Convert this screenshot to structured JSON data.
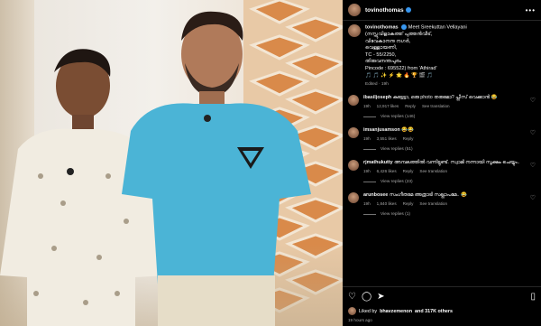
{
  "post": {
    "username": "tovinothomas"
  },
  "caption": {
    "username": "tovinothomas",
    "mention": "@",
    "line1": "Meet Sreekuttan Vellayani",
    "line2": "(നസ്സുവിളാകത്ത് പുത്തൻവീട്,",
    "line3": "വിവേകാനന്ദ നഗർ,",
    "line4": "വെള്ളായണി,",
    "line5": "TC - 55/2250,",
    "line6": "തിരുവനന്തപുരം",
    "line7": "Pincode : 695522) from 'Athirad'",
    "emojis": "🎵 🎵 ✨ ⚡ 🌟 🔥 🏆 🎬 🎵",
    "meta": "Edited · 19h"
  },
  "comments": [
    {
      "username": "ibasiljoseph",
      "text": "കുട്ടേട്ടാ, ഒരു photo തരുമോ? പ്ലീസ് വെക്കാൻ 😂",
      "time": "19h",
      "likes": "12,917 likes",
      "reply": "Reply",
      "translate": "See translation",
      "replies": "View replies (146)"
    },
    {
      "username": "imsanjusamson",
      "text": "😂😂",
      "time": "19h",
      "likes": "3,551 likes",
      "reply": "Reply",
      "translate": "",
      "replies": "View replies (51)"
    },
    {
      "username": "rjmathukutty",
      "text": "അമ്പലത്തിൽ വന്നിട്ടുണ്ട്. സ്വാമി നന്നായി സൂക്ഷം ചെയ്യും..",
      "time": "19h",
      "likes": "6,426 likes",
      "reply": "Reply",
      "translate": "See translation",
      "replies": "View replies (23)"
    },
    {
      "username": "arunbosee",
      "text": "സംഗീതമേ അത്രാടി സല്ലാപമേ.. 😂",
      "time": "19h",
      "likes": "1,840 likes",
      "reply": "Reply",
      "translate": "See translation",
      "replies": "View replies (1)"
    }
  ],
  "footer": {
    "liked_prefix": "Liked by",
    "liked_user": "bhavzemenon",
    "liked_suffix": "and 317K others",
    "time_ago": "19 hours ago"
  },
  "icons": {
    "heart": "heart-icon",
    "comment": "comment-icon",
    "share": "share-icon",
    "save": "bookmark-icon",
    "more": "more-options-icon"
  },
  "colors": {
    "panel_bg": "#000000",
    "muted": "#a8a8a8",
    "verified": "#3897f0",
    "shirt": "#4bb4d6"
  }
}
